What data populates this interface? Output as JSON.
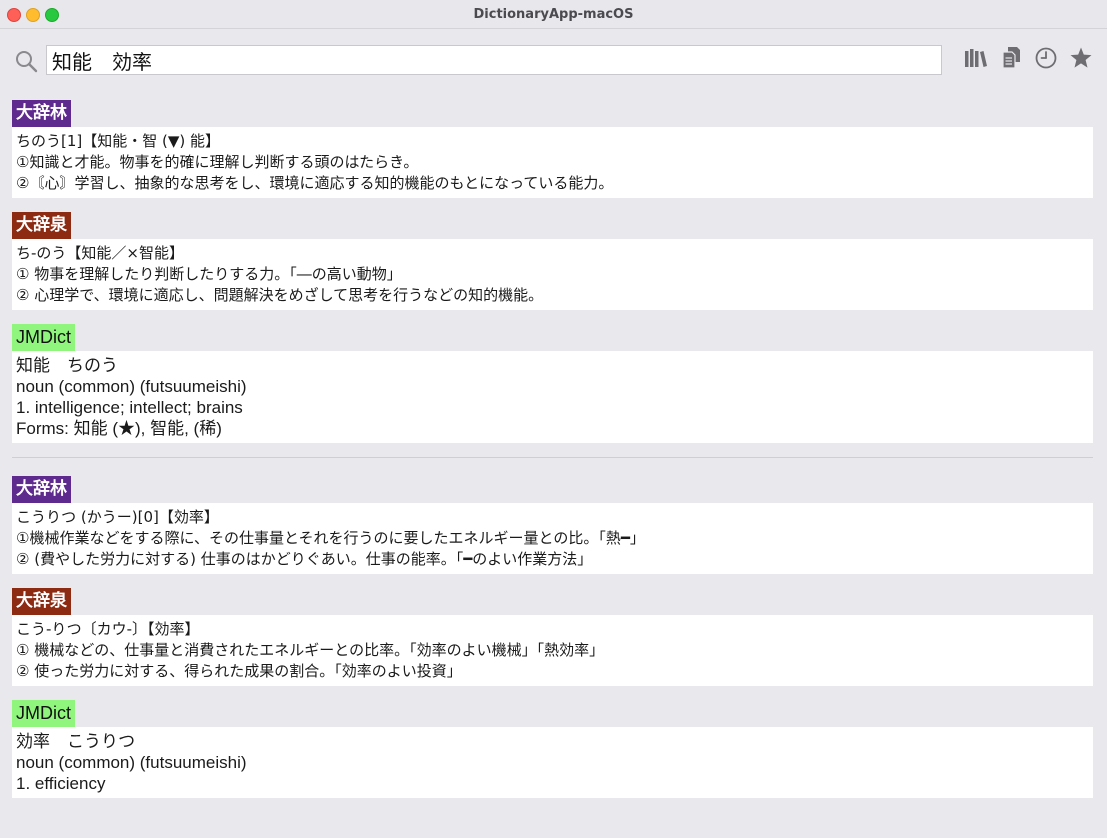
{
  "window": {
    "title": "DictionaryApp-macOS"
  },
  "search": {
    "query": "知能　効率"
  },
  "toolbar": {
    "icons": [
      "library-icon",
      "copy-icon",
      "history-icon",
      "favorite-star-icon"
    ]
  },
  "groups": [
    {
      "entries": [
        {
          "source": "大辞林",
          "lines": [
            "ちのう[1]【知能・智 (▼) 能】",
            "①知識と才能。物事を的確に理解し判断する頭のはたらき。",
            "②〘心〙学習し、抽象的な思考をし、環境に適応する知的機能のもとになっている能力。"
          ]
        },
        {
          "source": "大辞泉",
          "lines": [
            "ち-のう【知能／×智能】",
            "① 物事を理解したり判断したりする力。「―の高い動物」",
            "② 心理学で、環境に適応し、問題解決をめざして思考を行うなどの知的機能。"
          ]
        },
        {
          "source": "JMDict",
          "lines": [
            "知能　ちのう",
            "noun (common) (futsuumeishi)",
            "1. intelligence; intellect; brains",
            "Forms: 知能 (★), 智能, (稀)"
          ]
        }
      ]
    },
    {
      "entries": [
        {
          "source": "大辞林",
          "lines": [
            "こうりつ (かうー)[0]【効率】",
            "①機械作業などをする際に、その仕事量とそれを行うのに要したエネルギー量との比。「熱━」",
            "② (費やした労力に対する) 仕事のはかどりぐあい。仕事の能率。「━のよい作業方法」"
          ]
        },
        {
          "source": "大辞泉",
          "lines": [
            "こう-りつ〔カウ-〕【効率】",
            "① 機械などの、仕事量と消費されたエネルギーとの比率。「効率のよい機械」「熱効率」",
            "② 使った労力に対する、得られた成果の割合。「効率のよい投資」"
          ]
        },
        {
          "source": "JMDict",
          "lines": [
            "効率　こうりつ",
            "noun (common) (futsuumeishi)",
            "1. efficiency"
          ]
        }
      ]
    }
  ]
}
